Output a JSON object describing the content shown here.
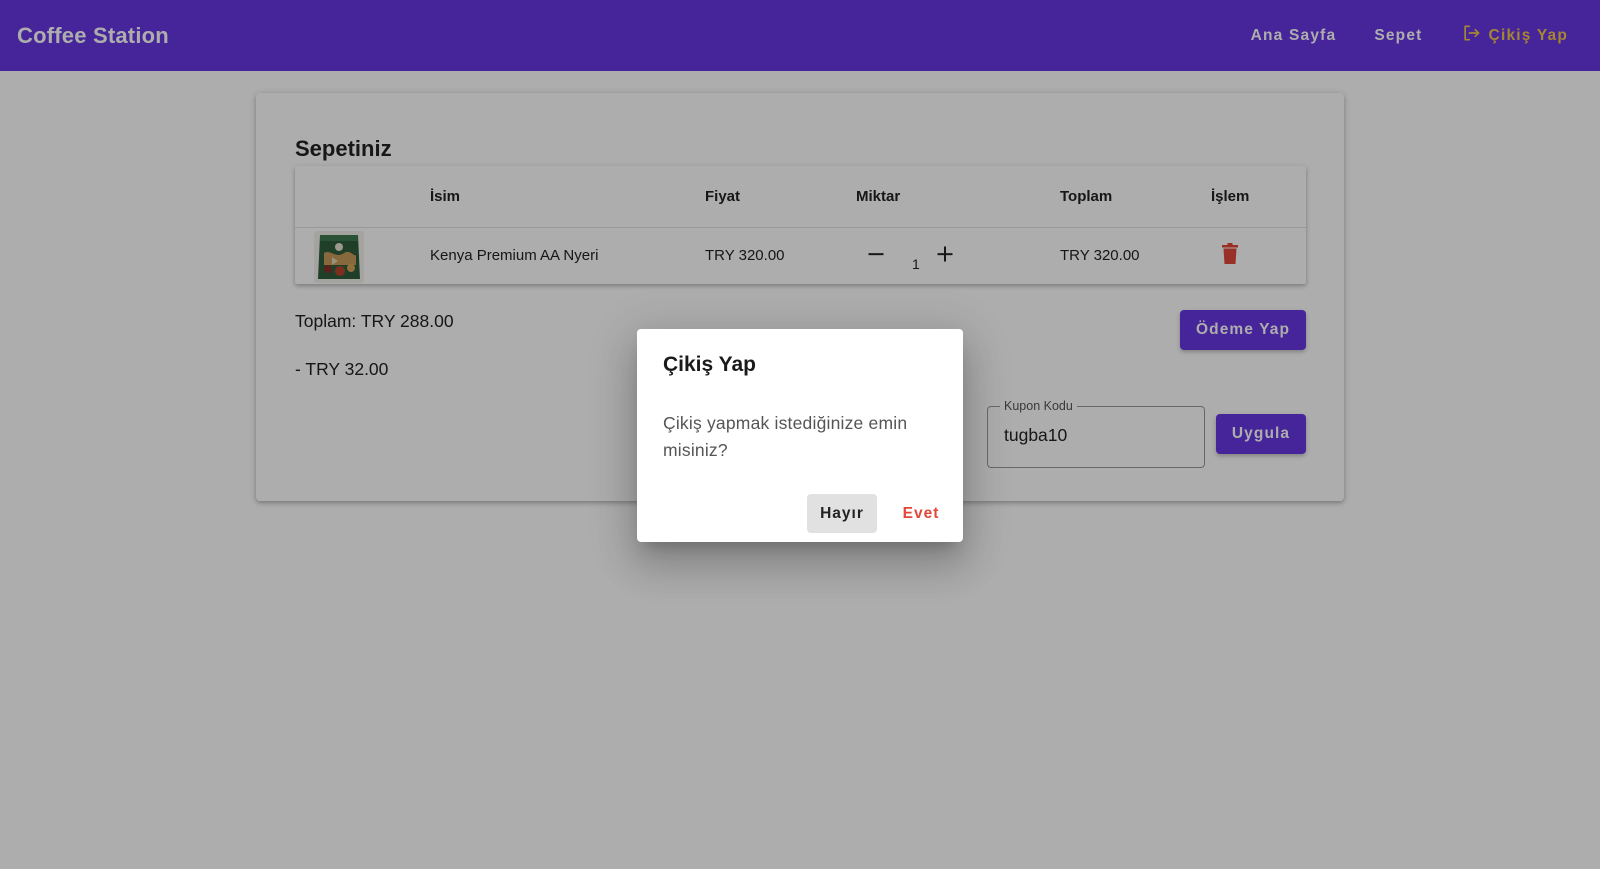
{
  "navbar": {
    "brand": "Coffee Station",
    "links": {
      "home": "Ana Sayfa",
      "cart": "Sepet",
      "logout": "Çikiş Yap"
    }
  },
  "cart": {
    "title": "Sepetiniz",
    "columns": {
      "name": "İsim",
      "price": "Fiyat",
      "quantity": "Miktar",
      "total": "Toplam",
      "action": "İşlem"
    },
    "items": [
      {
        "name": "Kenya Premium AA Nyeri",
        "price": "TRY 320.00",
        "quantity": "1",
        "total": "TRY 320.00"
      }
    ],
    "summary_total": "Toplam: TRY 288.00",
    "discount": "- TRY 32.00",
    "pay_button": "Ödeme Yap",
    "coupon": {
      "label": "Kupon Kodu",
      "value": "tugba10",
      "apply_button": "Uygula"
    }
  },
  "dialog": {
    "title": "Çikiş Yap",
    "message": "Çikiş yapmak istediğinize emin misiniz?",
    "no_button": "Hayır",
    "yes_button": "Evet"
  },
  "colors": {
    "primary": "#6735e2",
    "logout_accent": "#f3c64a",
    "danger": "#e2483a"
  }
}
